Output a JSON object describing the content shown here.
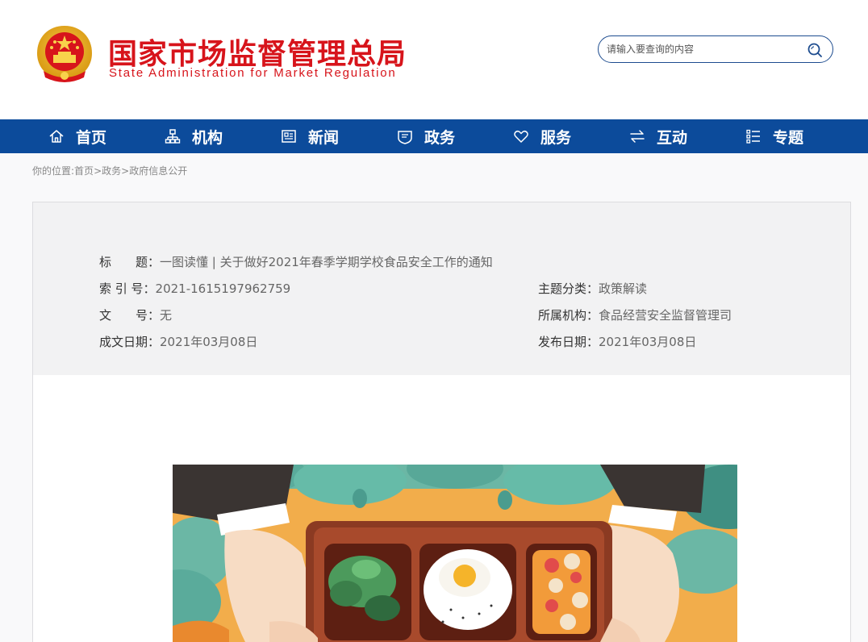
{
  "header": {
    "title_cn": "国家市场监督管理总局",
    "title_en": "State Administration for Market Regulation",
    "search_placeholder": "请输入要查询的内容"
  },
  "nav": {
    "items": [
      {
        "label": "首页",
        "icon": "home-icon"
      },
      {
        "label": "机构",
        "icon": "org-icon"
      },
      {
        "label": "新闻",
        "icon": "news-icon"
      },
      {
        "label": "政务",
        "icon": "affairs-icon"
      },
      {
        "label": "服务",
        "icon": "heart-icon"
      },
      {
        "label": "互动",
        "icon": "exchange-icon"
      },
      {
        "label": "专题",
        "icon": "topics-icon"
      }
    ]
  },
  "breadcrumb": {
    "prefix": "你的位置:",
    "items": [
      "首页",
      "政务",
      "政府信息公开"
    ],
    "separator": ">"
  },
  "info": {
    "title": {
      "label": "标　　题：",
      "value": "一图读懂 | 关于做好2021年春季学期学校食品安全工作的通知"
    },
    "index": {
      "label": "索 引 号：",
      "value": "2021-1615197962759"
    },
    "topic": {
      "label": "主题分类：",
      "value": "政策解读"
    },
    "doc_no": {
      "label": "文　　号：",
      "value": "无"
    },
    "org": {
      "label": "所属机构：",
      "value": "食品经营安全监督管理司"
    },
    "written_date": {
      "label": "成文日期：",
      "value": "2021年03月08日"
    },
    "publish_date": {
      "label": "发布日期：",
      "value": "2021年03月08日"
    }
  },
  "colors": {
    "brand_red": "#d7141b",
    "nav_blue": "#0c4b9b"
  }
}
